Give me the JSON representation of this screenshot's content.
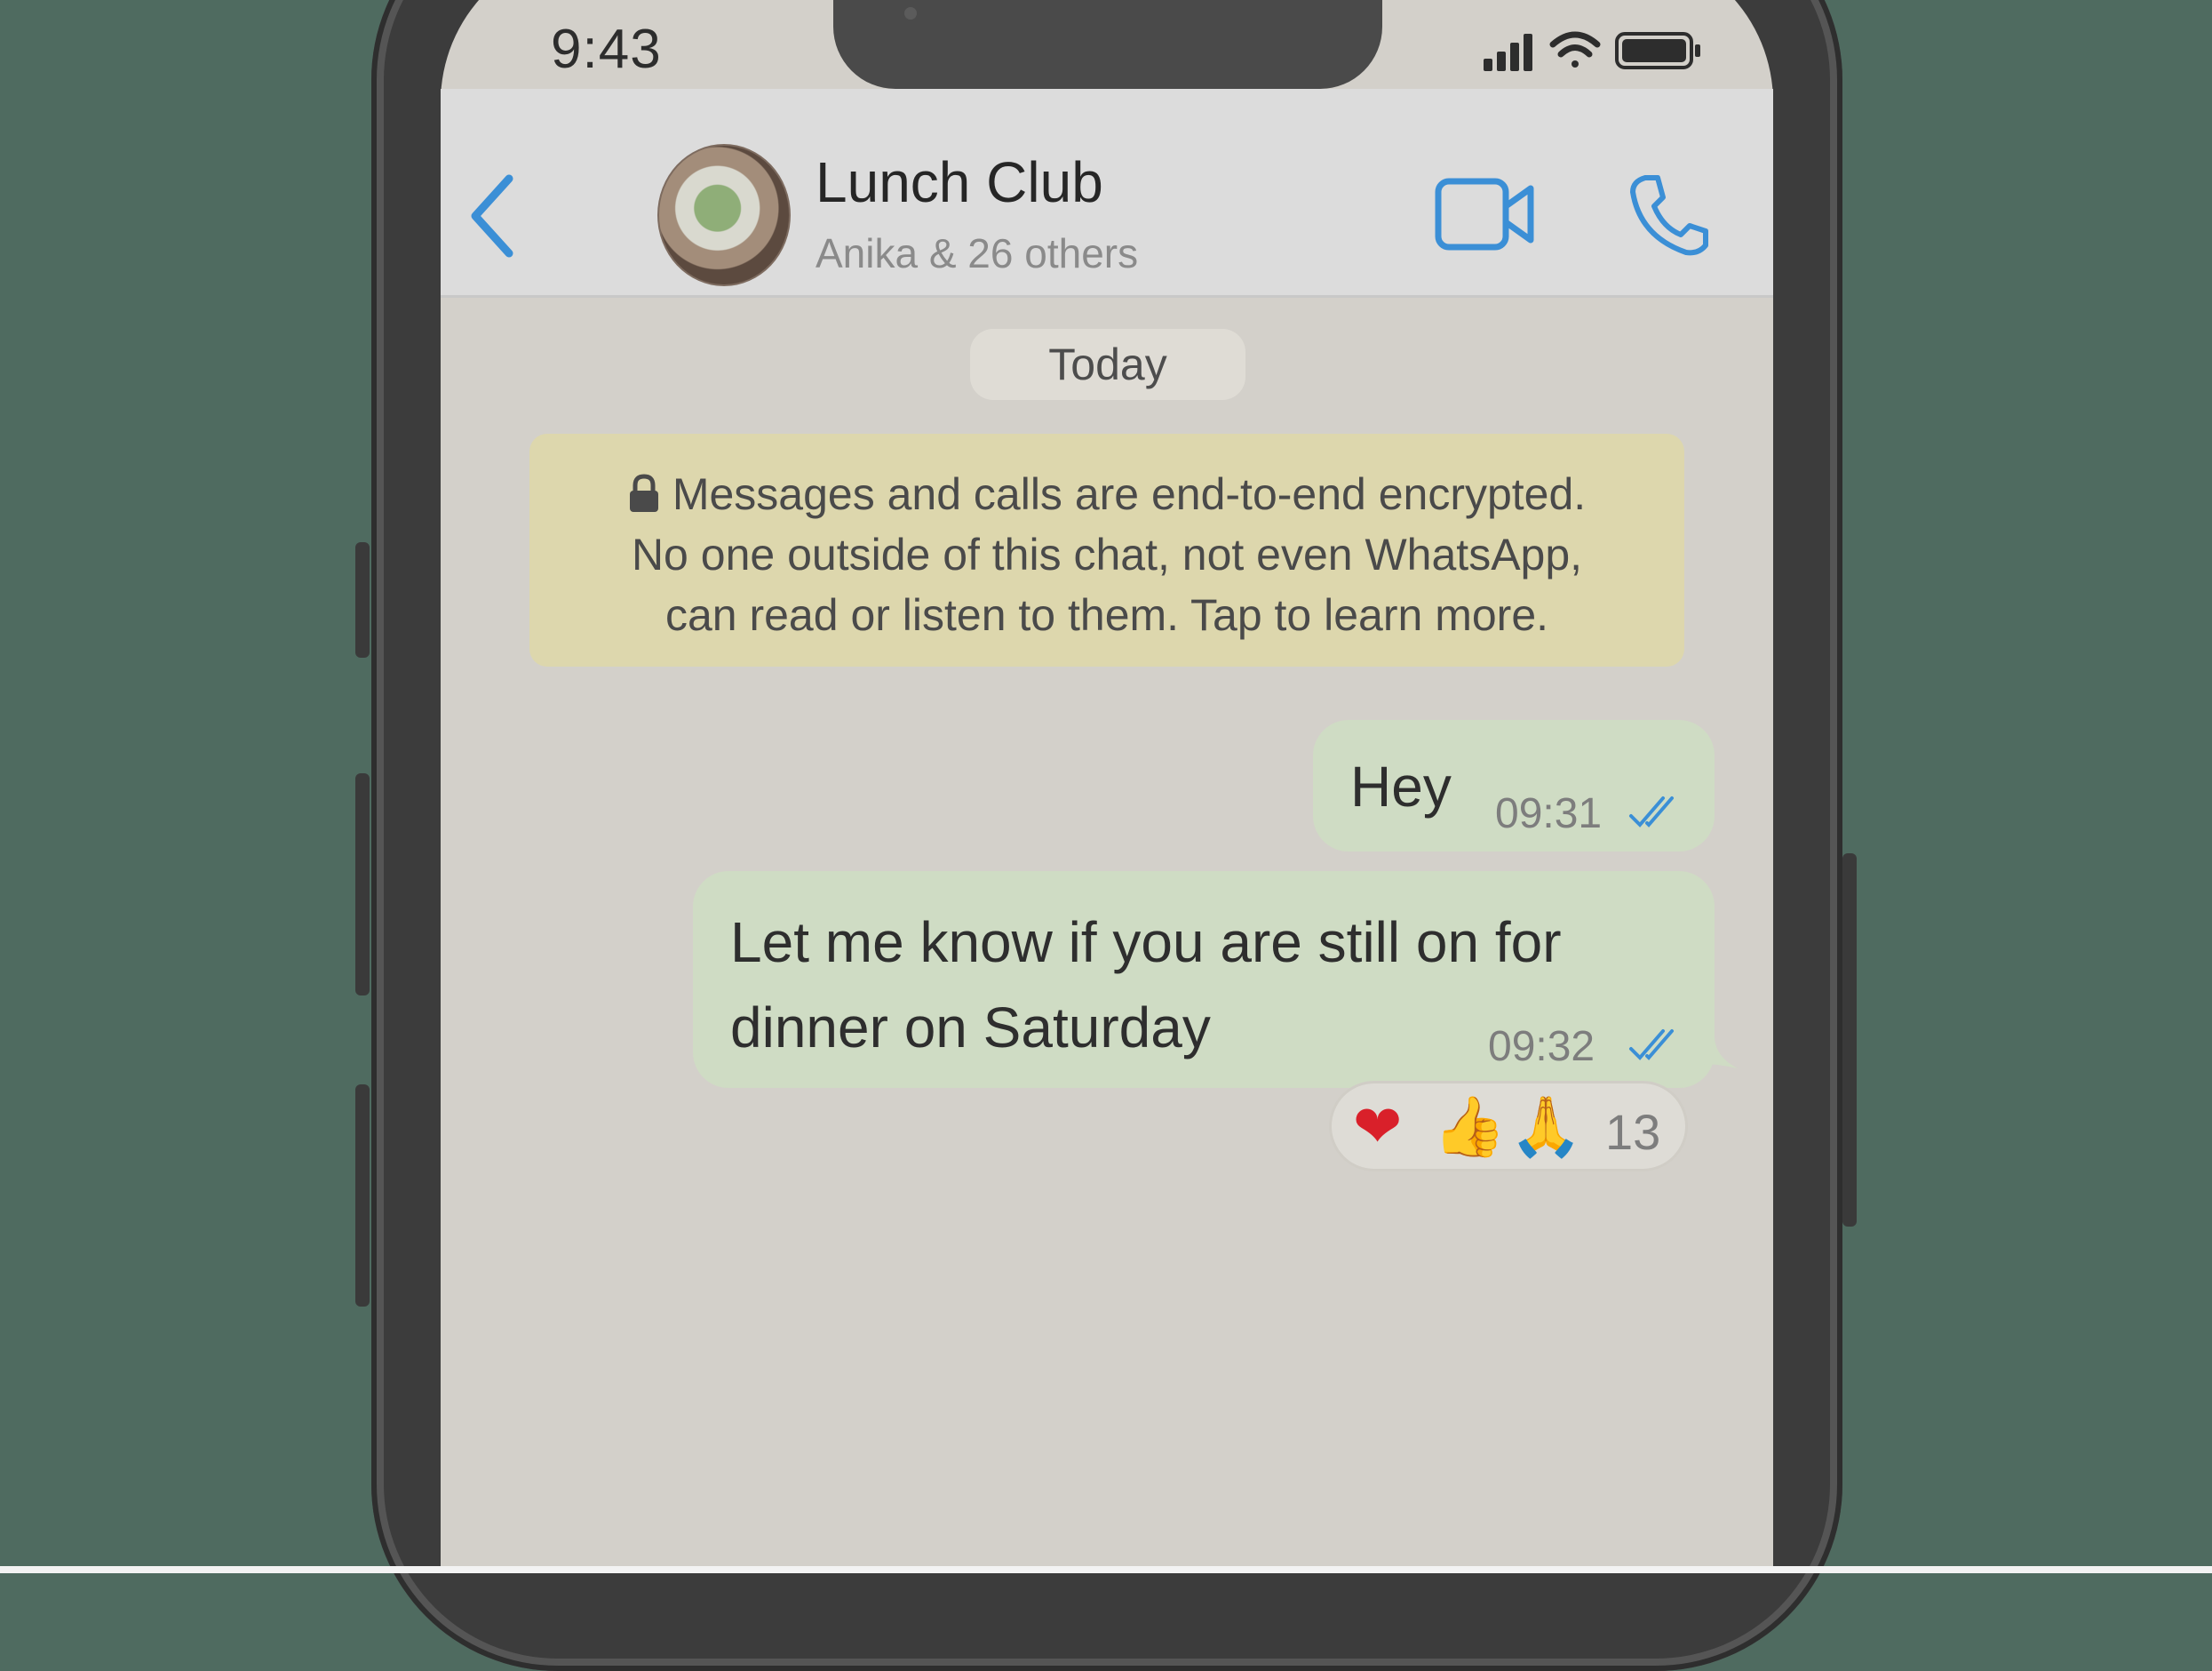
{
  "status_bar": {
    "time": "9:43"
  },
  "header": {
    "title": "Lunch Club",
    "subtitle": "Anika & 26 others"
  },
  "chat": {
    "date_separator": "Today",
    "encryption_notice": {
      "line1": "Messages and calls are end-to-end encrypted.",
      "line2": "No one outside of this chat, not even WhatsApp,",
      "line3": "can read or listen to them. Tap to learn more."
    },
    "messages": [
      {
        "text": "Hey",
        "time": "09:31",
        "status": "read"
      },
      {
        "text": "Let me know if you are still on for dinner on Saturday",
        "time": "09:32",
        "status": "read"
      }
    ],
    "reactions": {
      "emojis": [
        "❤",
        "👍",
        "🙏"
      ],
      "count": "13"
    }
  },
  "colors": {
    "accent": "#3b8fd6",
    "outgoing_bubble": "#cfdcc4",
    "notice_bg": "#ddd7ad",
    "chat_bg": "#d3d0ca",
    "backdrop": "#4f6b60"
  },
  "icons": [
    "back-chevron-icon",
    "video-call-icon",
    "voice-call-icon",
    "lock-icon",
    "signal-icon",
    "wifi-icon",
    "battery-icon",
    "double-check-icon"
  ]
}
